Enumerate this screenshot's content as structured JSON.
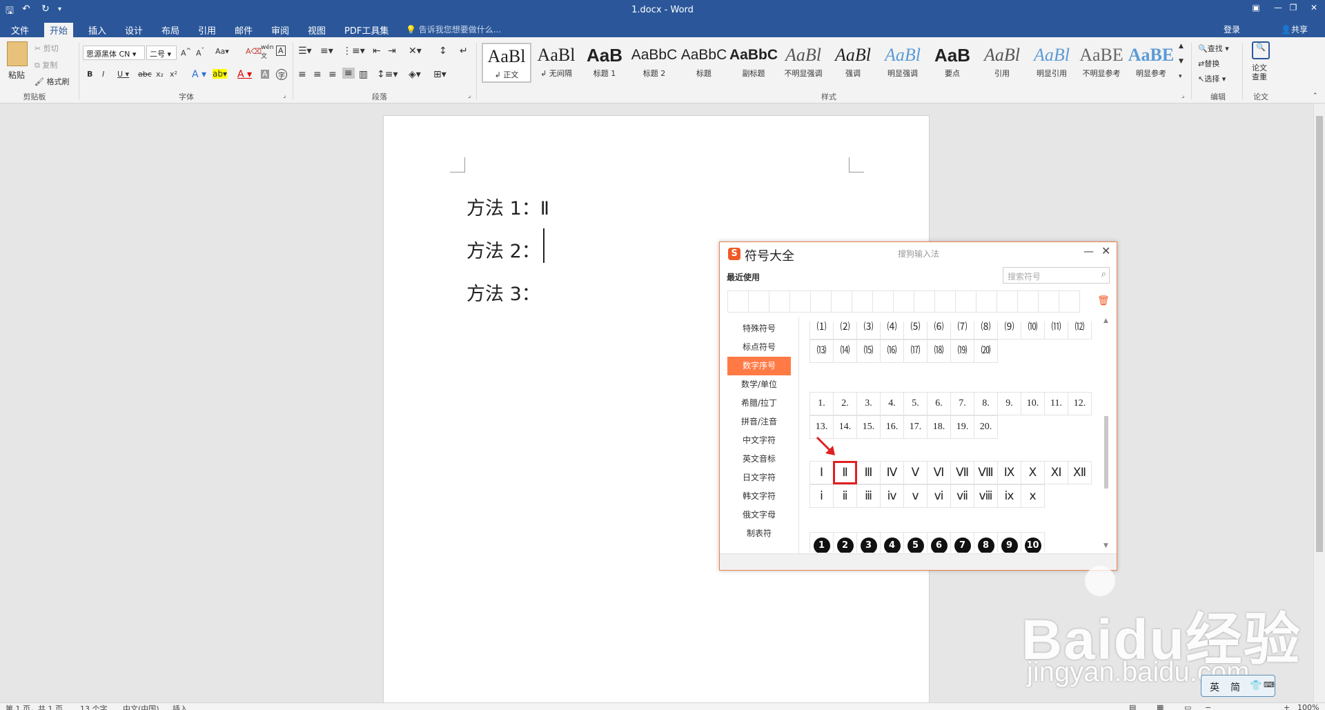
{
  "titlebar": {
    "doc_title": "1.docx - Word",
    "save_icon": "save-icon",
    "undo_icon": "undo-icon",
    "redo_icon": "redo-icon",
    "customize_icon": "customize-icon"
  },
  "tabs": [
    {
      "label": "文件"
    },
    {
      "label": "开始"
    },
    {
      "label": "插入"
    },
    {
      "label": "设计"
    },
    {
      "label": "布局"
    },
    {
      "label": "引用"
    },
    {
      "label": "邮件"
    },
    {
      "label": "审阅"
    },
    {
      "label": "视图"
    },
    {
      "label": "PDF工具集"
    }
  ],
  "tell_me": "告诉我您想要做什么...",
  "login": "登录",
  "share": "共享",
  "clipboard": {
    "paste": "粘贴",
    "cut": "剪切",
    "copy": "复制",
    "format_painter": "格式刷",
    "label": "剪贴板"
  },
  "font": {
    "name": "思源黑体 CN",
    "size": "二号",
    "label": "字体"
  },
  "paragraph": {
    "label": "段落"
  },
  "styles": {
    "label": "样式",
    "items": [
      {
        "sample": "AaBl",
        "name": "↲ 正文"
      },
      {
        "sample": "AaBl",
        "name": "↲ 无间隔"
      },
      {
        "sample": "AaB",
        "name": "标题 1"
      },
      {
        "sample": "AaBbC",
        "name": "标题 2"
      },
      {
        "sample": "AaBbC",
        "name": "标题"
      },
      {
        "sample": "AaBbC",
        "name": "副标题"
      },
      {
        "sample": "AaBl",
        "name": "不明显强调"
      },
      {
        "sample": "AaBl",
        "name": "强调"
      },
      {
        "sample": "AaBl",
        "name": "明显强调"
      },
      {
        "sample": "AaB",
        "name": "要点"
      },
      {
        "sample": "AaBl",
        "name": "引用"
      },
      {
        "sample": "AaBl",
        "name": "明显引用"
      },
      {
        "sample": "AaBE",
        "name": "不明显参考"
      },
      {
        "sample": "AaBE",
        "name": "明显参考"
      }
    ]
  },
  "editing": {
    "find": "查找",
    "replace": "替换",
    "select": "选择",
    "label": "编辑"
  },
  "thesis": {
    "check": "论文查重",
    "label": "论文"
  },
  "document": {
    "lines": [
      "方法 1：Ⅱ",
      "方法 2：",
      "方法 3："
    ]
  },
  "statusbar": {
    "page": "第 1 页，共 1 页",
    "words": "13 个字",
    "lang": "中文(中国)",
    "mode": "插入",
    "zoom": "100%"
  },
  "symbol_dialog": {
    "title": "符号大全",
    "subtitle": "搜狗输入法",
    "recent_label": "最近使用",
    "search_placeholder": "搜索符号",
    "categories": [
      {
        "label": "特殊符号"
      },
      {
        "label": "标点符号"
      },
      {
        "label": "数字序号"
      },
      {
        "label": "数学/单位"
      },
      {
        "label": "希腊/拉丁"
      },
      {
        "label": "拼音/注音"
      },
      {
        "label": "中文字符"
      },
      {
        "label": "英文音标"
      },
      {
        "label": "日文字符"
      },
      {
        "label": "韩文字符"
      },
      {
        "label": "俄文字母"
      },
      {
        "label": "制表符"
      }
    ],
    "active_category": "数字序号",
    "paren_row1": [
      "⑴",
      "⑵",
      "⑶",
      "⑷",
      "⑸",
      "⑹",
      "⑺",
      "⑻",
      "⑼",
      "⑽",
      "⑾",
      "⑿"
    ],
    "paren_row2": [
      "⒀",
      "⒁",
      "⒂",
      "⒃",
      "⒄",
      "⒅",
      "⒆",
      "⒇"
    ],
    "dot_row1": [
      "1.",
      "2.",
      "3.",
      "4.",
      "5.",
      "6.",
      "7.",
      "8.",
      "9.",
      "10.",
      "11.",
      "12."
    ],
    "dot_row2": [
      "13.",
      "14.",
      "15.",
      "16.",
      "17.",
      "18.",
      "19.",
      "20."
    ],
    "roman_upper": [
      "Ⅰ",
      "Ⅱ",
      "Ⅲ",
      "Ⅳ",
      "Ⅴ",
      "Ⅵ",
      "Ⅶ",
      "Ⅷ",
      "Ⅸ",
      "Ⅹ",
      "Ⅺ",
      "Ⅻ"
    ],
    "roman_lower": [
      "ⅰ",
      "ⅱ",
      "ⅲ",
      "ⅳ",
      "ⅴ",
      "ⅵ",
      "ⅶ",
      "ⅷ",
      "ⅸ",
      "ⅹ"
    ],
    "circled": [
      "1",
      "2",
      "3",
      "4",
      "5",
      "6",
      "7",
      "8",
      "9",
      "10"
    ],
    "highlighted_symbol": "Ⅱ",
    "highlight_color": "#e02020",
    "accent_color": "#ff7a45"
  },
  "watermark": {
    "main": "Baidu经验",
    "url": "jingyan.baidu.com"
  },
  "ime": {
    "mode1": "英",
    "mode2": "简"
  },
  "colors": {
    "word_blue": "#2b579a",
    "ribbon_bg": "#f3f3f3",
    "sogou_orange": "#f05a24"
  }
}
